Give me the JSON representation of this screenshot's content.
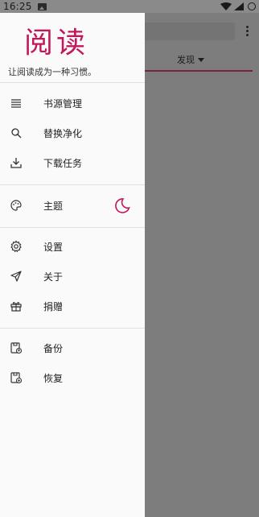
{
  "status_bar": {
    "time": "16:25"
  },
  "background": {
    "tab_label": "发现"
  },
  "drawer": {
    "logo": "阅读",
    "slogan": "让阅读成为一种习惯。",
    "items": [
      {
        "label": "书源管理",
        "icon": "list-icon"
      },
      {
        "label": "替换净化",
        "icon": "find-replace-icon"
      },
      {
        "label": "下载任务",
        "icon": "download-icon"
      },
      {
        "label": "主题",
        "icon": "palette-icon"
      },
      {
        "label": "设置",
        "icon": "gear-icon"
      },
      {
        "label": "关于",
        "icon": "send-icon"
      },
      {
        "label": "捐赠",
        "icon": "gift-icon"
      },
      {
        "label": "备份",
        "icon": "backup-icon"
      },
      {
        "label": "恢复",
        "icon": "restore-icon"
      }
    ]
  },
  "colors": {
    "accent": "#c2185b",
    "tab_indicator": "#7a2340"
  }
}
